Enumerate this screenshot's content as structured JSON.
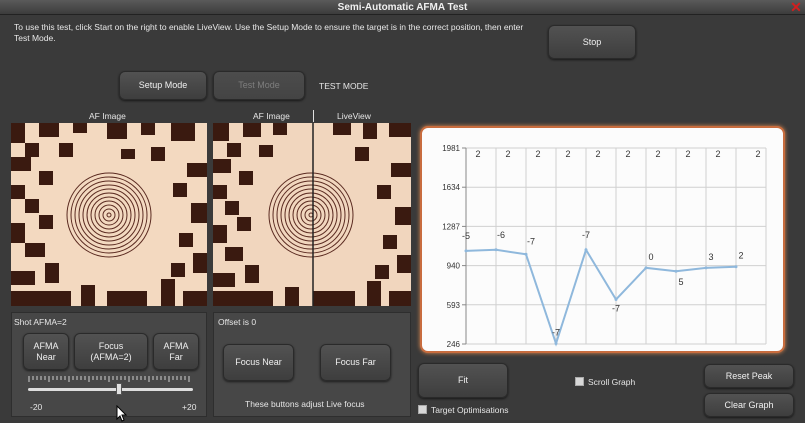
{
  "window": {
    "title": "Semi-Automatic AFMA Test"
  },
  "instructions": "To use this test, click Start on the right to enable LiveView.  Use the Setup Mode to ensure the target is in the correct position, then enter Test Mode.",
  "toolbar": {
    "stop_label": "Stop",
    "setup_mode_label": "Setup Mode",
    "test_mode_label": "Test Mode",
    "mode_status": "TEST MODE"
  },
  "images": {
    "af_image_label": "AF Image",
    "af_image_label_2": "AF Image",
    "liveview_label": "LiveView"
  },
  "shot_panel": {
    "title": "Shot AFMA=2",
    "afma_near_label": "AFMA\nNear",
    "focus_label": "Focus\n(AFMA=2)",
    "afma_far_label": "AFMA\nFar",
    "slider_min": "-20",
    "slider_max": "+20",
    "slider_value": 2
  },
  "offset_panel": {
    "title": "Offset is 0",
    "focus_near_label": "Focus Near",
    "focus_far_label": "Focus Far",
    "note": "These buttons adjust Live focus"
  },
  "controls": {
    "fit_label": "Fit",
    "scroll_graph_label": "Scroll Graph",
    "scroll_graph_checked": false,
    "target_opt_label": "Target Optimisations",
    "target_opt_checked": false,
    "reset_peak_label": "Reset Peak",
    "clear_graph_label": "Clear Graph"
  },
  "chart_data": {
    "type": "line",
    "y_ticks": [
      "1981",
      "1634",
      "1287",
      "940",
      "593",
      "246"
    ],
    "ylim": [
      246,
      1981
    ],
    "top_labels": [
      "2",
      "2",
      "2",
      "2",
      "2",
      "2",
      "2",
      "2",
      "2",
      "2"
    ],
    "x": [
      0,
      1,
      2,
      3,
      4,
      5,
      6,
      7,
      8,
      9,
      10
    ],
    "values": [
      1070,
      1080,
      1040,
      250,
      1080,
      640,
      920,
      890,
      920,
      930
    ],
    "point_labels": [
      "-5",
      "-6",
      "-7",
      "-7",
      "-7",
      "-7",
      "0",
      "5",
      "3",
      "2"
    ],
    "line_color": "#8fb8dc",
    "grid": true
  },
  "colors": {
    "accent": "#c86c3e",
    "background": "#3a3a3a"
  }
}
